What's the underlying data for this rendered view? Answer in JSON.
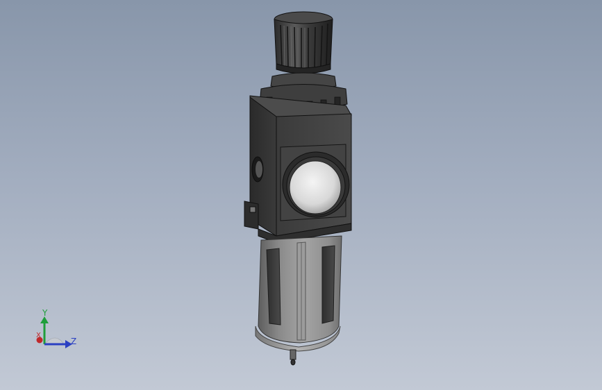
{
  "viewport": {
    "background_top": "#8896aa",
    "background_bottom": "#c2c9d5"
  },
  "model": {
    "icon": "filter-regulator-3d-model",
    "body_color": "#3c3c3c",
    "bowl_color": "#8e8e8e"
  },
  "triad": {
    "y_label": "Y",
    "z_label": "Z",
    "x_label": "X",
    "y_color": "#1e9e3a",
    "z_color": "#2a3fc2",
    "x_color": "#c0282a"
  }
}
